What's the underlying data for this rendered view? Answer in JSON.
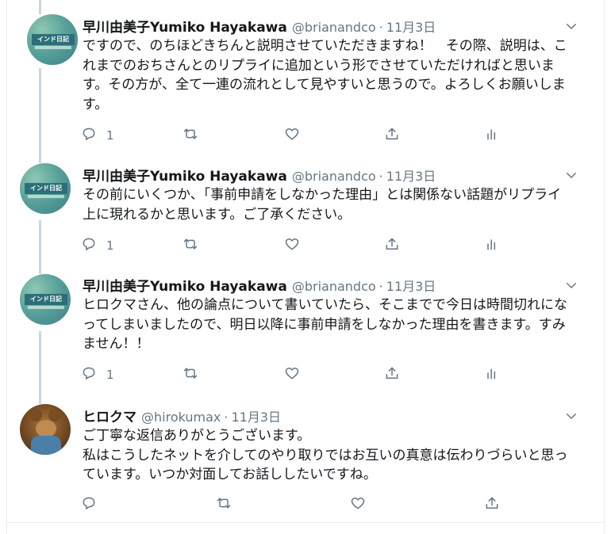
{
  "tweets": [
    {
      "author": "早川由美子Yumiko Hayakawa",
      "handle": "@brianandco",
      "separator": "·",
      "date": "11月3日",
      "text": "ですので、のちほどきちんと説明させていただきますね！　その際、説明は、これまでのおちさんとのリプライに追加という形でさせていただければと思います。その方が、全て一連の流れとして見やすいと思うので。よろしくお願いします。",
      "reply_count": "1",
      "avatar_text": "インド日記"
    },
    {
      "author": "早川由美子Yumiko Hayakawa",
      "handle": "@brianandco",
      "separator": "·",
      "date": "11月3日",
      "text": "その前にいくつか、「事前申請をしなかった理由」とは関係ない話題がリプライ上に現れるかと思います。ご了承ください。",
      "reply_count": "1",
      "avatar_text": "インド日記"
    },
    {
      "author": "早川由美子Yumiko Hayakawa",
      "handle": "@brianandco",
      "separator": "·",
      "date": "11月3日",
      "text": "ヒロクマさん、他の論点について書いていたら、そこまでで今日は時間切れになってしまいましたので、明日以降に事前申請をしなかった理由を書きます。すみません！！",
      "reply_count": "1",
      "avatar_text": "インド日記"
    },
    {
      "author": "ヒロクマ",
      "handle": "@hirokumax",
      "separator": "·",
      "date": "11月3日",
      "text": "ご丁寧な返信ありがとうございます。\n私はこうしたネットを介してのやり取りではお互いの真意は伝わりづらいと思っています。いつか対面してお話ししたいですね。",
      "reply_count": ""
    }
  ],
  "colors": {
    "text": "#14171a",
    "secondary": "#657786",
    "border": "#e6ecf0",
    "thread_line": "#ccd6dd",
    "icon": "#657786"
  },
  "icons": [
    "reply-icon",
    "retweet-icon",
    "like-icon",
    "share-icon",
    "analytics-icon",
    "chevron-down-icon"
  ]
}
